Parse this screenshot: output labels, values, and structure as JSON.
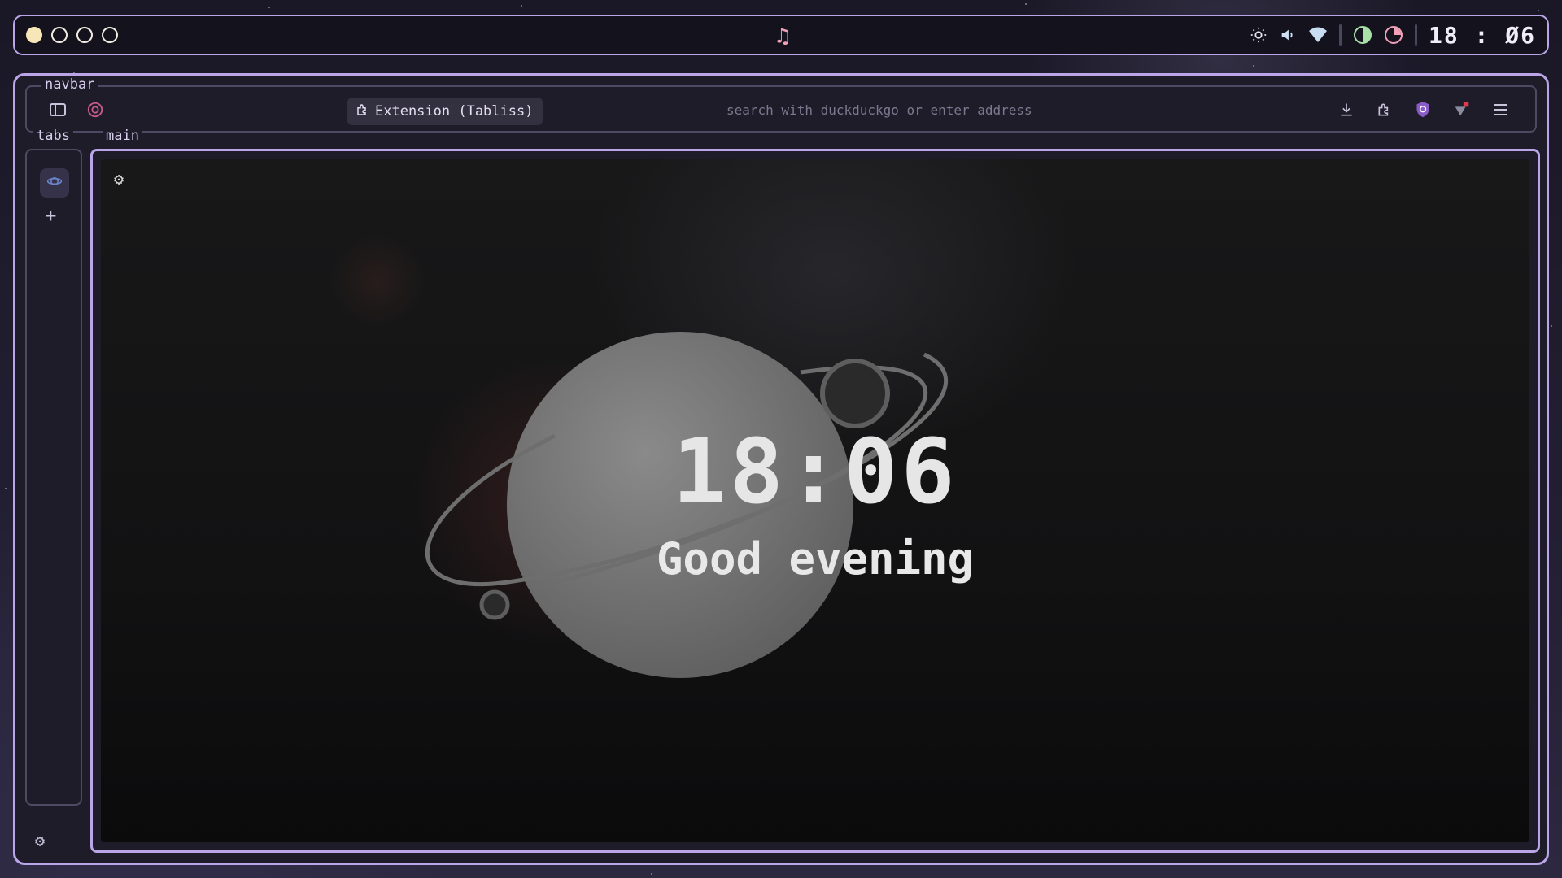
{
  "topbar": {
    "workspaces": [
      {
        "icon": "workspace-active-dot",
        "active": true
      },
      {
        "icon": "workspace-dot",
        "active": false
      },
      {
        "icon": "workspace-dot",
        "active": false
      },
      {
        "icon": "workspace-dot",
        "active": false
      }
    ],
    "music_icon": "music-note-icon",
    "tray_icons": [
      "brightness-icon",
      "volume-icon",
      "wifi-icon",
      "contrast-icon",
      "pie-timer-icon"
    ],
    "clock": "18 : Ø6"
  },
  "browser": {
    "navbar_label": "navbar",
    "tabs_label": "tabs",
    "main_label": "main",
    "extension_pill": "Extension (Tabliss)",
    "url_placeholder": "search with duckduckgo or enter address",
    "navbar_right_icons": [
      "download-icon",
      "extension-icon",
      "shield-icon",
      "notification-icon",
      "menu-icon"
    ]
  },
  "newtab": {
    "time": "18:06",
    "greeting": "Good evening"
  },
  "colors": {
    "accent": "#b9a5e8",
    "music": "#f2a0b8",
    "workspace_active": "#f6e6b8"
  }
}
